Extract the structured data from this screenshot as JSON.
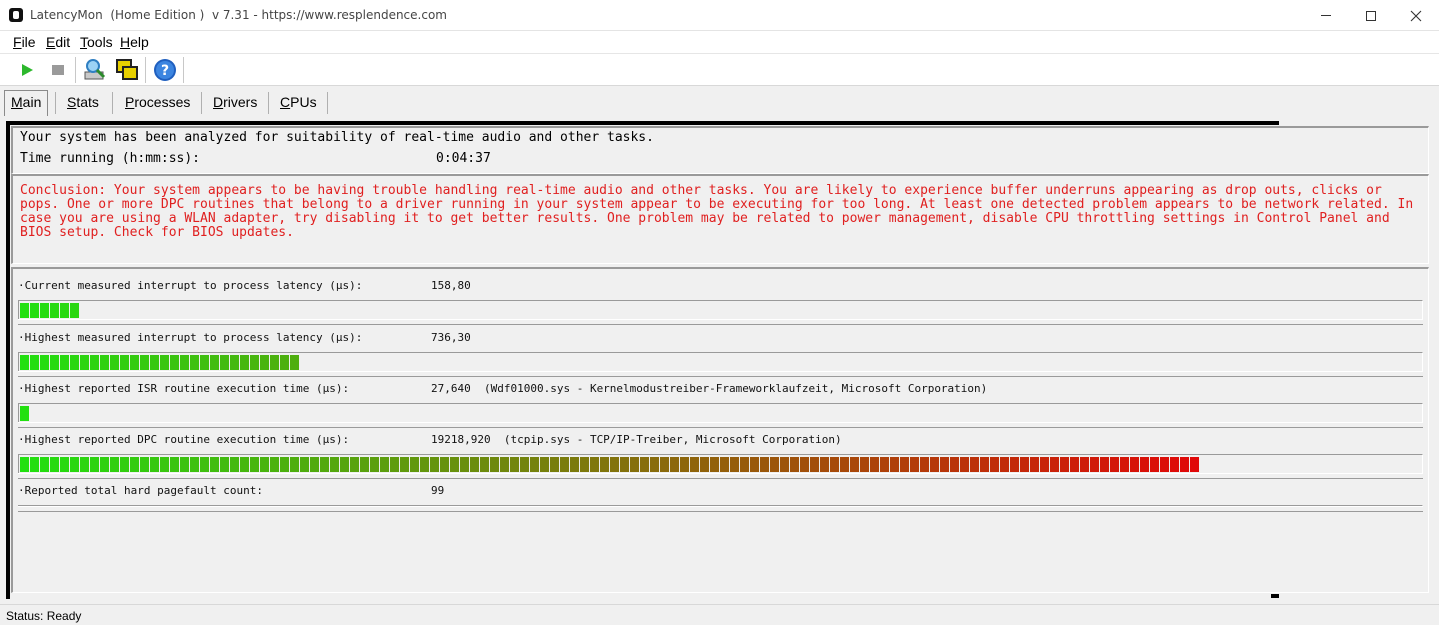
{
  "window": {
    "title": "LatencyMon  (Home Edition )  v 7.31 - https://www.resplendence.com"
  },
  "menu": [
    "File",
    "Edit",
    "Tools",
    "Help"
  ],
  "toolbar": [
    {
      "name": "start-icon",
      "color": "#2db82d"
    },
    {
      "name": "stop-icon",
      "color": "#9a9a9a"
    },
    {
      "name": "driver-search-icon",
      "color": "#2f7fc2"
    },
    {
      "name": "windows-icon",
      "color": "#e8d000"
    },
    {
      "name": "help-icon",
      "color": "#1f5fbf"
    }
  ],
  "tabs": [
    "Main",
    "Stats",
    "Processes",
    "Drivers",
    "CPUs"
  ],
  "info": {
    "line1": "Your system has been analyzed for suitability of real-time audio and other tasks.",
    "time_label": "Time running (h:mm:ss):",
    "time_value": "0:04:37"
  },
  "conclusion": "Conclusion: Your system appears to be having trouble handling real-time audio and other tasks. You are likely to experience buffer underruns appearing as drop outs, clicks or pops. One or more DPC routines that belong to a driver running in your system appear to be executing for too long. At least one detected problem appears to be network related. In case you are using a WLAN adapter, try disabling it to get better results. One problem may be related to power management, disable CPU throttling settings in Control Panel and BIOS setup. Check for BIOS updates.",
  "metrics": [
    {
      "label": "·Current measured interrupt to process latency (µs):",
      "value": "158,80",
      "segments": 6
    },
    {
      "label": "·Highest measured interrupt to process latency (µs):",
      "value": "736,30",
      "segments": 28
    },
    {
      "label": "·Highest reported ISR routine execution time (µs):",
      "value": "27,640  (Wdf01000.sys - Kernelmodustreiber-Frameworklaufzeit, Microsoft Corporation)",
      "segments": 1
    },
    {
      "label": "·Highest reported DPC routine execution time (µs):",
      "value": "19218,920  (tcpip.sys - TCP/IP-Treiber, Microsoft Corporation)",
      "segments": 118
    },
    {
      "label": "·Reported total hard pagefault count:",
      "value": "99",
      "segments": 0
    }
  ],
  "bar_colors": {
    "start": "#22e010",
    "end": "#e00808"
  },
  "status": "Status: Ready"
}
